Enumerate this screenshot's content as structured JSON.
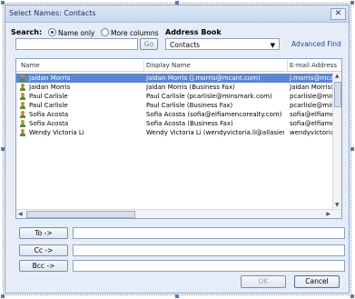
{
  "window": {
    "title": "Select Names: Contacts",
    "close_glyph": "✕"
  },
  "search": {
    "label": "Search:",
    "option_name_only": "Name only",
    "option_more_columns": "More columns",
    "selected_option": "Name only",
    "input_value": "",
    "go_label": "Go"
  },
  "address_book": {
    "label": "Address Book",
    "selected": "Contacts",
    "advanced_find": "Advanced Find"
  },
  "list": {
    "columns": [
      "Name",
      "Display Name",
      "E-mail Address"
    ],
    "rows": [
      {
        "name": "Jaidan Morris",
        "display": "Jaidan Morris (j.morris@mcant.com)",
        "email": "j.morris@mcant...",
        "selected": true
      },
      {
        "name": "Jaidan Morris",
        "display": "Jaidan Morris (Business Fax)",
        "email": "Jaidan Morris@...",
        "selected": false
      },
      {
        "name": "Paul Carlisle",
        "display": "Paul Carlisle (pcarlisle@minsmark.com)",
        "email": "pcarlisle@min...",
        "selected": false
      },
      {
        "name": "Paul Carlisle",
        "display": "Paul Carlisle (Business Fax)",
        "email": "pcarlisle@mins...",
        "selected": false
      },
      {
        "name": "Sofia Acosta",
        "display": "Sofia Acosta (sofia@elfiamencorealty.com)",
        "email": "sofia@elfiame...",
        "selected": false
      },
      {
        "name": "Sofia Acosta",
        "display": "Sofia Acosta (Business Fax)",
        "email": "sofia@elfiame...",
        "selected": false
      },
      {
        "name": "Wendy Victoria Li",
        "display": "Wendy Victoria Li (wendyvictoria.li@allasien...",
        "email": "wendyvictoria...",
        "selected": false
      }
    ]
  },
  "recipients": {
    "to_label": "To ->",
    "cc_label": "Cc ->",
    "bcc_label": "Bcc ->",
    "to_value": "",
    "cc_value": "",
    "bcc_value": ""
  },
  "footer": {
    "ok_label": "OK",
    "cancel_label": "Cancel"
  },
  "colors": {
    "selection": "#5b87cf",
    "dialog_bg": "#e6edf8",
    "link": "#1f45a8"
  },
  "icons": {
    "contact": "person-icon",
    "close": "close-icon",
    "dropdown": "chevron-down-icon"
  }
}
